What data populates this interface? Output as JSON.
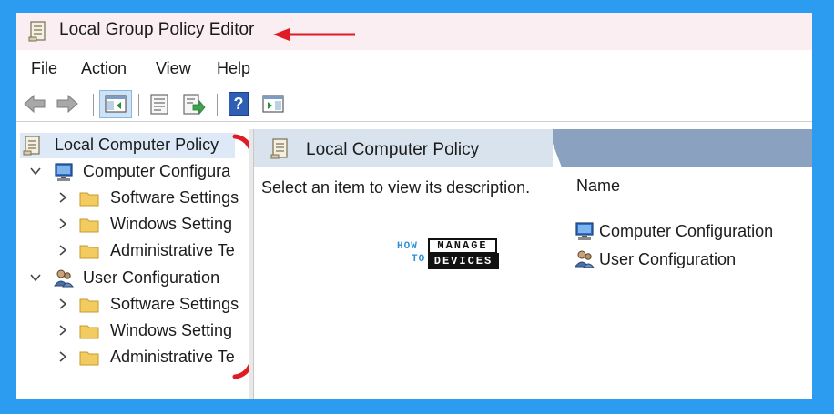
{
  "window": {
    "title": "Local Group Policy Editor"
  },
  "menu": [
    "File",
    "Action",
    "View",
    "Help"
  ],
  "toolbar": {
    "icons": [
      "back-arrow-icon",
      "forward-arrow-icon",
      "show-hide-console-tree-icon",
      "properties-icon",
      "export-list-icon",
      "help-icon",
      "show-hide-action-pane-icon"
    ],
    "help_glyph": "?"
  },
  "tree": {
    "root": "Local Computer Policy",
    "computer": {
      "label": "Computer Configura",
      "children": [
        "Software Settings",
        "Windows Setting",
        "Administrative Te"
      ]
    },
    "user": {
      "label": "User Configuration",
      "children": [
        "Software Settings",
        "Windows Setting",
        "Administrative Te"
      ]
    }
  },
  "details": {
    "header": "Local Computer Policy",
    "description": "Select an item to view its description.",
    "column_name": "Name",
    "items": [
      "Computer Configuration",
      "User Configuration"
    ]
  },
  "watermark": {
    "how": "HOW",
    "to": "TO",
    "manage": "MANAGE",
    "devices": "DEVICES"
  },
  "colors": {
    "frame": "#2b9cf0",
    "titlebar": "#fbeef2",
    "details_header": "#8aa2bf",
    "details_tab": "#d9e3ee",
    "annotation": "#e01b24",
    "folder": "#f2cb61"
  }
}
